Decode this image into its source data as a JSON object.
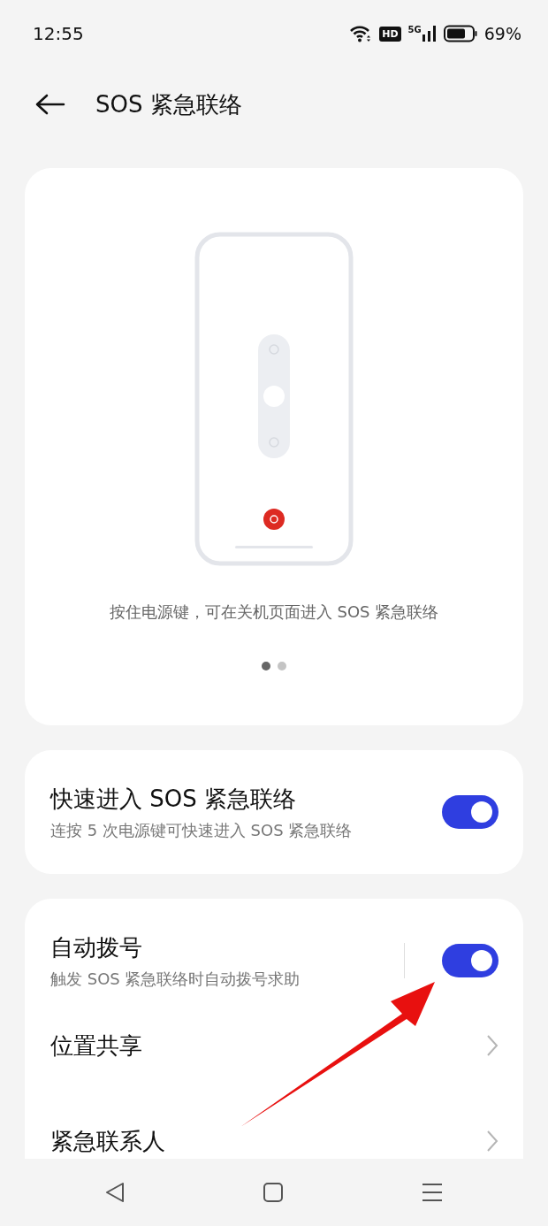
{
  "status_bar": {
    "time": "12:55",
    "hd": "HD",
    "network": "5G",
    "battery": "69%"
  },
  "header": {
    "title": "SOS 紧急联络"
  },
  "guide_card": {
    "caption": "按住电源键，可在关机页面进入 SOS 紧急联络",
    "pages": [
      {
        "selected": true
      },
      {
        "selected": false
      }
    ]
  },
  "quick_entry": {
    "title": "快速进入 SOS 紧急联络",
    "subtitle": "连按 5 次电源键可快速进入 SOS 紧急联络",
    "on": true
  },
  "settings": [
    {
      "kind": "toggle",
      "title": "自动拨号",
      "subtitle": "触发 SOS 紧急联络时自动拨号求助",
      "on": true
    },
    {
      "kind": "link",
      "title": "位置共享"
    },
    {
      "kind": "link",
      "title": "紧急联系人"
    }
  ]
}
